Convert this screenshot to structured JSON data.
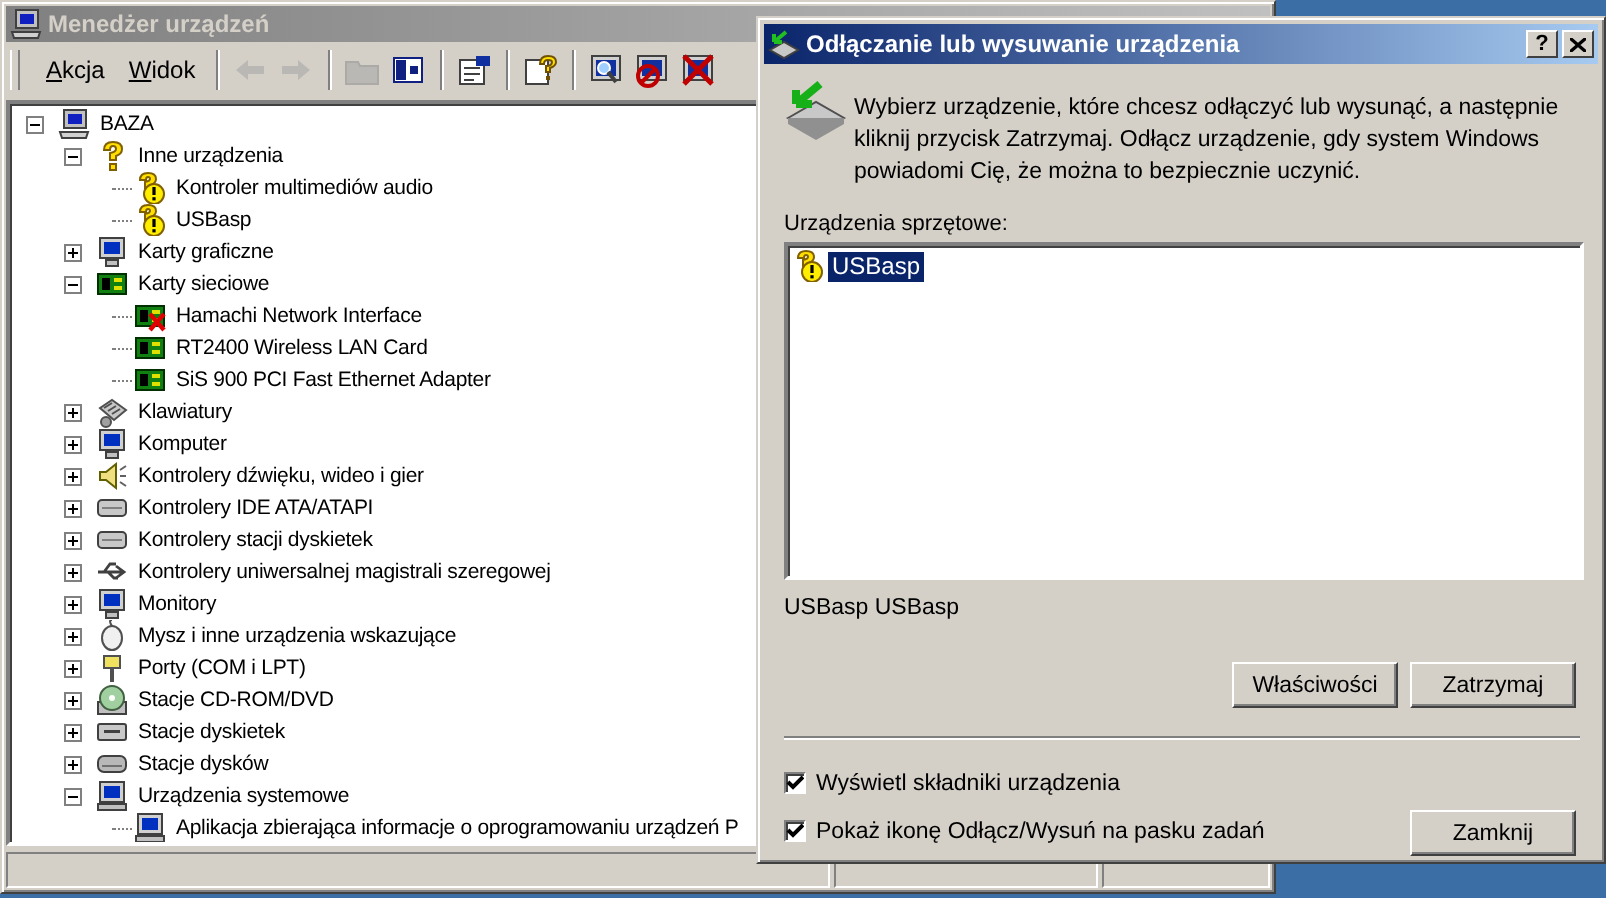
{
  "main_window": {
    "title": "Menedżer urządzeń",
    "menu": [
      {
        "label": "Akcja"
      },
      {
        "label": "Widok"
      }
    ],
    "toolbar_groups": [
      [
        {
          "kind": "back",
          "disabled": true
        },
        {
          "kind": "forward",
          "disabled": true
        }
      ],
      [
        {
          "kind": "folder",
          "disabled": true
        },
        {
          "kind": "panel",
          "disabled": false
        }
      ],
      [
        {
          "kind": "properties",
          "disabled": false
        }
      ],
      [
        {
          "kind": "help",
          "disabled": false
        }
      ],
      [
        {
          "kind": "scan",
          "disabled": false
        },
        {
          "kind": "disable",
          "disabled": false
        },
        {
          "kind": "uninstall",
          "disabled": false
        }
      ]
    ],
    "tree": [
      {
        "label": "BAZA",
        "kind": "computer",
        "expanded": true,
        "children": [
          {
            "label": "Inne urządzenia",
            "kind": "unknown",
            "expanded": true,
            "children": [
              {
                "label": "Kontroler multimediów audio",
                "kind": "unknown-device"
              },
              {
                "label": "USBasp",
                "kind": "unknown-device"
              }
            ]
          },
          {
            "label": "Karty graficzne",
            "kind": "monitor",
            "expanded": false
          },
          {
            "label": "Karty sieciowe",
            "kind": "network",
            "expanded": true,
            "children": [
              {
                "label": "Hamachi Network Interface",
                "kind": "network",
                "disabled": true
              },
              {
                "label": "RT2400 Wireless LAN Card",
                "kind": "network",
                "disabled": false
              },
              {
                "label": "SiS 900 PCI Fast Ethernet Adapter",
                "kind": "network",
                "disabled": false
              }
            ]
          },
          {
            "label": "Klawiatury",
            "kind": "keyboard",
            "expanded": false
          },
          {
            "label": "Komputer",
            "kind": "monitor",
            "expanded": false
          },
          {
            "label": "Kontrolery dźwięku, wideo i gier",
            "kind": "sound",
            "expanded": false
          },
          {
            "label": "Kontrolery IDE ATA/ATAPI",
            "kind": "controller",
            "expanded": false
          },
          {
            "label": "Kontrolery stacji dyskietek",
            "kind": "controller",
            "expanded": false
          },
          {
            "label": "Kontrolery uniwersalnej magistrali szeregowej",
            "kind": "usb",
            "expanded": false
          },
          {
            "label": "Monitory",
            "kind": "monitor",
            "expanded": false
          },
          {
            "label": "Mysz i inne urządzenia wskazujące",
            "kind": "mouse",
            "expanded": false
          },
          {
            "label": "Porty (COM i LPT)",
            "kind": "port",
            "expanded": false
          },
          {
            "label": "Stacje CD-ROM/DVD",
            "kind": "cdrom",
            "expanded": false
          },
          {
            "label": "Stacje dyskietek",
            "kind": "floppy",
            "expanded": false
          },
          {
            "label": "Stacje dysków",
            "kind": "disk",
            "expanded": false
          },
          {
            "label": "Urządzenia systemowe",
            "kind": "system",
            "expanded": true,
            "children": [
              {
                "label": "Aplikacja zbierająca informacje o oprogramowaniu urządzeń P",
                "kind": "system"
              }
            ]
          }
        ]
      }
    ]
  },
  "dialog": {
    "title": "Odłączanie lub wysuwanie urządzenia",
    "help_button": "?",
    "description": "Wybierz urządzenie, które chcesz odłączyć lub wysunąć, a następnie kliknij przycisk Zatrzymaj. Odłącz urządzenie, gdy system Windows powiadomi Cię, że można to bezpiecznie uczynić.",
    "list_label": "Urządzenia sprzętowe:",
    "devices": [
      {
        "label": "USBasp",
        "selected": true
      }
    ],
    "device_details": "USBasp USBasp",
    "buttons": [
      {
        "label": "Właściwości"
      },
      {
        "label": "Zatrzymaj"
      }
    ],
    "options": [
      {
        "label": "Wyświetl składniki urządzenia",
        "checked": true
      },
      {
        "label": "Pokaż ikonę Odłącz/Wysuń na pasku zadań",
        "checked": true
      }
    ],
    "close_button": "Zamknij"
  }
}
